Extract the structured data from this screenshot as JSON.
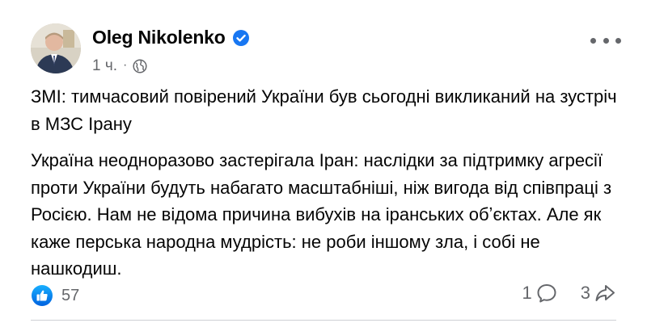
{
  "post": {
    "author": {
      "name": "Oleg Nikolenko",
      "verified": true
    },
    "meta": {
      "time": "1 ч.",
      "separator": "·",
      "audience_icon": "globe-icon"
    },
    "more_icon": "more-options-icon",
    "paragraphs": [
      "ЗМІ: тимчасовий повірений України був сьогодні викликаний на зустріч в МЗС Ірану",
      "Україна неодноразово застерігала Іран: наслідки за підтримку агресії проти України будуть набагато масштабніші, ніж вигода від співпраці з Росією. Нам не відома причина вибухів на іранських обʼєктах. Але як каже перська народна мудрість: не роби іншому зла, і собі не нашкодиш."
    ],
    "reactions": {
      "icon": "like-icon",
      "count": "57"
    },
    "stats": {
      "comments": "1",
      "comment_icon": "comment-icon",
      "shares": "3",
      "share_icon": "share-icon"
    },
    "colors": {
      "accent": "#1877f2",
      "text": "#050505",
      "secondary": "#65676b"
    }
  }
}
